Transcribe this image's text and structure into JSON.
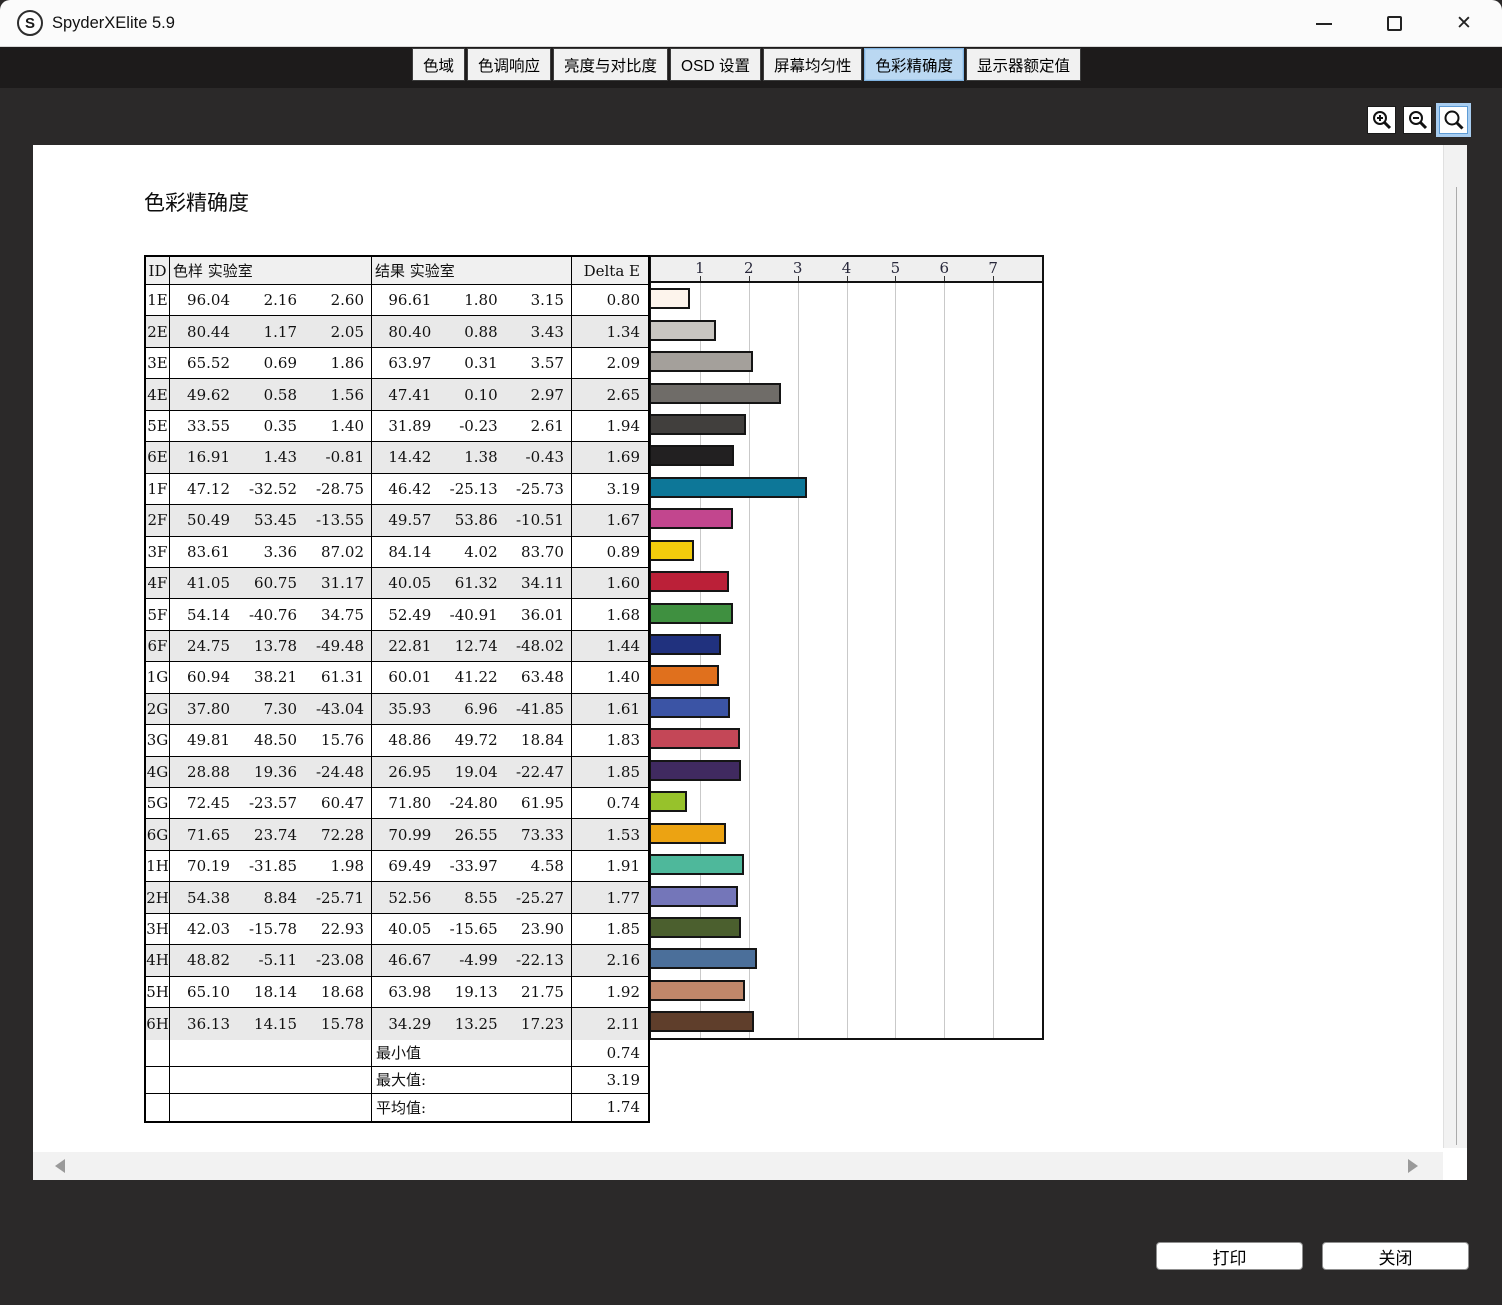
{
  "window": {
    "title": "SpyderXElite 5.9",
    "logo_letter": "S"
  },
  "tabs": [
    {
      "name": "gamut",
      "label": "色域",
      "active": false
    },
    {
      "name": "tone-response",
      "label": "色调响应",
      "active": false
    },
    {
      "name": "brightness-contrast",
      "label": "亮度与对比度",
      "active": false
    },
    {
      "name": "osd-settings",
      "label": "OSD 设置",
      "active": false
    },
    {
      "name": "screen-uniformity",
      "label": "屏幕均匀性",
      "active": false
    },
    {
      "name": "color-accuracy",
      "label": "色彩精确度",
      "active": true
    },
    {
      "name": "monitor-rating",
      "label": "显示器额定值",
      "active": false
    }
  ],
  "report": {
    "title": "色彩精确度",
    "table": {
      "headers": {
        "id": "ID",
        "sample": "色样  实验室",
        "result": "结果  实验室",
        "delta": "Delta E"
      },
      "rows": [
        {
          "id": "1E",
          "sample": [
            "96.04",
            "2.16",
            "2.60"
          ],
          "result": [
            "96.61",
            "1.80",
            "3.15"
          ],
          "delta": "0.80",
          "color": "#fdf4ec"
        },
        {
          "id": "2E",
          "sample": [
            "80.44",
            "1.17",
            "2.05"
          ],
          "result": [
            "80.40",
            "0.88",
            "3.43"
          ],
          "delta": "1.34",
          "color": "#c9c6c1"
        },
        {
          "id": "3E",
          "sample": [
            "65.52",
            "0.69",
            "1.86"
          ],
          "result": [
            "63.97",
            "0.31",
            "3.57"
          ],
          "delta": "2.09",
          "color": "#a4a09b"
        },
        {
          "id": "4E",
          "sample": [
            "49.62",
            "0.58",
            "1.56"
          ],
          "result": [
            "47.41",
            "0.10",
            "2.97"
          ],
          "delta": "2.65",
          "color": "#6f6c68"
        },
        {
          "id": "5E",
          "sample": [
            "33.55",
            "0.35",
            "1.40"
          ],
          "result": [
            "31.89",
            "-0.23",
            "2.61"
          ],
          "delta": "1.94",
          "color": "#413f3d"
        },
        {
          "id": "6E",
          "sample": [
            "16.91",
            "1.43",
            "-0.81"
          ],
          "result": [
            "14.42",
            "1.38",
            "-0.43"
          ],
          "delta": "1.69",
          "color": "#222021"
        },
        {
          "id": "1F",
          "sample": [
            "47.12",
            "-32.52",
            "-28.75"
          ],
          "result": [
            "46.42",
            "-25.13",
            "-25.73"
          ],
          "delta": "3.19",
          "color": "#0d7798"
        },
        {
          "id": "2F",
          "sample": [
            "50.49",
            "53.45",
            "-13.55"
          ],
          "result": [
            "49.57",
            "53.86",
            "-10.51"
          ],
          "delta": "1.67",
          "color": "#c2468e"
        },
        {
          "id": "3F",
          "sample": [
            "83.61",
            "3.36",
            "87.02"
          ],
          "result": [
            "84.14",
            "4.02",
            "83.70"
          ],
          "delta": "0.89",
          "color": "#f2cc0c"
        },
        {
          "id": "4F",
          "sample": [
            "41.05",
            "60.75",
            "31.17"
          ],
          "result": [
            "40.05",
            "61.32",
            "34.11"
          ],
          "delta": "1.60",
          "color": "#bb2038"
        },
        {
          "id": "5F",
          "sample": [
            "54.14",
            "-40.76",
            "34.75"
          ],
          "result": [
            "52.49",
            "-40.91",
            "36.01"
          ],
          "delta": "1.68",
          "color": "#3f9040"
        },
        {
          "id": "6F",
          "sample": [
            "24.75",
            "13.78",
            "-49.48"
          ],
          "result": [
            "22.81",
            "12.74",
            "-48.02"
          ],
          "delta": "1.44",
          "color": "#20317e"
        },
        {
          "id": "1G",
          "sample": [
            "60.94",
            "38.21",
            "61.31"
          ],
          "result": [
            "60.01",
            "41.22",
            "63.48"
          ],
          "delta": "1.40",
          "color": "#e0701d"
        },
        {
          "id": "2G",
          "sample": [
            "37.80",
            "7.30",
            "-43.04"
          ],
          "result": [
            "35.93",
            "6.96",
            "-41.85"
          ],
          "delta": "1.61",
          "color": "#3b54a5"
        },
        {
          "id": "3G",
          "sample": [
            "49.81",
            "48.50",
            "15.76"
          ],
          "result": [
            "48.86",
            "49.72",
            "18.84"
          ],
          "delta": "1.83",
          "color": "#c44757"
        },
        {
          "id": "4G",
          "sample": [
            "28.88",
            "19.36",
            "-24.48"
          ],
          "result": [
            "26.95",
            "19.04",
            "-22.47"
          ],
          "delta": "1.85",
          "color": "#402a60"
        },
        {
          "id": "5G",
          "sample": [
            "72.45",
            "-23.57",
            "60.47"
          ],
          "result": [
            "71.80",
            "-24.80",
            "61.95"
          ],
          "delta": "0.74",
          "color": "#97c22b"
        },
        {
          "id": "6G",
          "sample": [
            "71.65",
            "23.74",
            "72.28"
          ],
          "result": [
            "70.99",
            "26.55",
            "73.33"
          ],
          "delta": "1.53",
          "color": "#eca312"
        },
        {
          "id": "1H",
          "sample": [
            "70.19",
            "-31.85",
            "1.98"
          ],
          "result": [
            "69.49",
            "-33.97",
            "4.58"
          ],
          "delta": "1.91",
          "color": "#4eb89b"
        },
        {
          "id": "2H",
          "sample": [
            "54.38",
            "8.84",
            "-25.71"
          ],
          "result": [
            "52.56",
            "8.55",
            "-25.27"
          ],
          "delta": "1.77",
          "color": "#7476b9"
        },
        {
          "id": "3H",
          "sample": [
            "42.03",
            "-15.78",
            "22.93"
          ],
          "result": [
            "40.05",
            "-15.65",
            "23.90"
          ],
          "delta": "1.85",
          "color": "#4b5f2e"
        },
        {
          "id": "4H",
          "sample": [
            "48.82",
            "-5.11",
            "-23.08"
          ],
          "result": [
            "46.67",
            "-4.99",
            "-22.13"
          ],
          "delta": "2.16",
          "color": "#4b6f9a"
        },
        {
          "id": "5H",
          "sample": [
            "65.10",
            "18.14",
            "18.68"
          ],
          "result": [
            "63.98",
            "19.13",
            "21.75"
          ],
          "delta": "1.92",
          "color": "#c0876a"
        },
        {
          "id": "6H",
          "sample": [
            "36.13",
            "14.15",
            "15.78"
          ],
          "result": [
            "34.29",
            "13.25",
            "17.23"
          ],
          "delta": "2.11",
          "color": "#5f3e2b"
        }
      ],
      "summary": [
        {
          "label": "最小值",
          "value": "0.74"
        },
        {
          "label": "最大值:",
          "value": "3.19"
        },
        {
          "label": "平均值:",
          "value": "1.74"
        }
      ]
    },
    "chart": {
      "tick_labels": [
        "1",
        "2",
        "3",
        "4",
        "5",
        "6",
        "7"
      ],
      "axis_max": 8
    }
  },
  "footer": {
    "print_label": "打印",
    "close_label": "关闭"
  }
}
